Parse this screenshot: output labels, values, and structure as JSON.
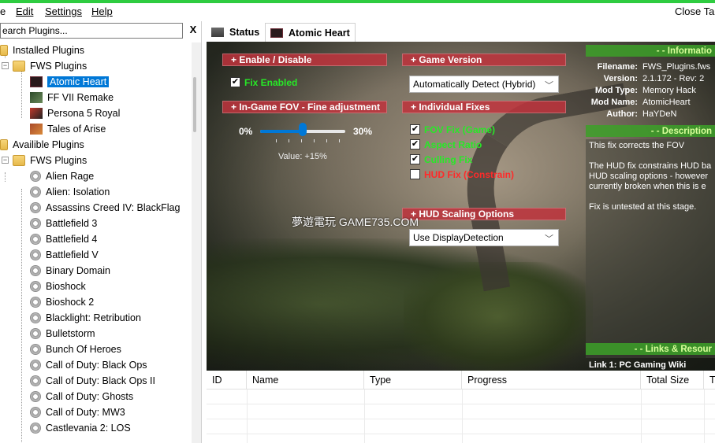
{
  "menu": {
    "file": "e",
    "edit": "Edit",
    "settings": "Settings",
    "help": "Help",
    "close_tab": "Close Ta"
  },
  "sidebar": {
    "search_placeholder": "earch Plugins...",
    "search_clear": "X",
    "installed_label": "Installed Plugins",
    "installed_group": "FWS Plugins",
    "installed_items": [
      "Atomic Heart",
      "FF VII Remake",
      "Persona 5 Royal",
      "Tales of Arise"
    ],
    "available_label": "Availible Plugins",
    "available_group": "FWS Plugins",
    "available_items": [
      "Alien Rage",
      "Alien: Isolation",
      "Assassins Creed IV: BlackFlag",
      "Battlefield 3",
      "Battlefield 4",
      "Battlefield V",
      "Binary Domain",
      "Bioshock",
      "Bioshock 2",
      "Blacklight: Retribution",
      "Bulletstorm",
      "Bunch Of Heroes",
      "Call of Duty: Black Ops",
      "Call of Duty: Black Ops II",
      "Call of Duty: Ghosts",
      "Call of Duty: MW3",
      "Castlevania 2: LOS"
    ],
    "selected_item": "Atomic Heart"
  },
  "tabs": {
    "status": "Status",
    "plugin": "Atomic Heart"
  },
  "panel": {
    "enable_header": "+ Enable / Disable",
    "fix_enabled": "Fix Enabled",
    "fov_header": "+ In-Game FOV - Fine adjustment",
    "slider_min": "0%",
    "slider_max": "30%",
    "slider_value_label": "Value: +15%",
    "slider_value": 0.5,
    "game_version_header": "+ Game Version",
    "game_version_value": "Automatically Detect (Hybrid)",
    "individual_header": "+ Individual Fixes",
    "fixes": [
      {
        "label": "FOV Fix (Game)",
        "checked": true,
        "state": "enabled"
      },
      {
        "label": "Aspect Ratio",
        "checked": true,
        "state": "enabled"
      },
      {
        "label": "Culling Fix",
        "checked": true,
        "state": "enabled"
      },
      {
        "label": "HUD Fix (Constrain)",
        "checked": false,
        "state": "disabled"
      }
    ],
    "hud_header": "+ HUD Scaling Options",
    "hud_value": "Use DisplayDetection",
    "watermark": "夢遊電玩 GAME735.COM"
  },
  "info": {
    "header": "- - Informatio",
    "rows": [
      {
        "key": "Filename:",
        "value": "FWS_Plugins.fws"
      },
      {
        "key": "Version:",
        "value": "2.1.172 - Rev: 2"
      },
      {
        "key": "Mod Type:",
        "value": "Memory Hack"
      },
      {
        "key": "Mod Name:",
        "value": "AtomicHeart"
      },
      {
        "key": "Author:",
        "value": "HaYDeN"
      }
    ],
    "desc_header": "- - Description",
    "description": "This fix corrects the FOV\n\nThe HUD fix constrains HUD ba\nHUD scaling options - however\ncurrently broken when this is e\n\nFix is untested at this stage.",
    "links_header": "- - Links & Resour",
    "link1": "Link 1: PC Gaming Wiki"
  },
  "grid": {
    "columns": [
      "ID",
      "Name",
      "Type",
      "Progress",
      "Total Size",
      "Ti"
    ]
  },
  "colors": {
    "accent": "#0078d7",
    "top_bar": "#2ecc40",
    "section_red": "#be323c",
    "section_green": "#3ca028"
  }
}
